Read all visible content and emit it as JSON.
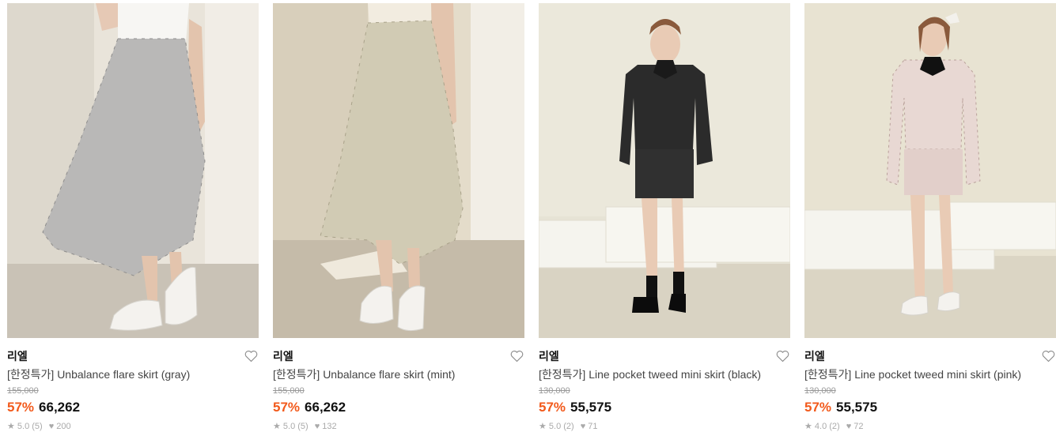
{
  "products": [
    {
      "brand": "리엘",
      "name": "[한정특가] Unbalance flare skirt (gray)",
      "original_price": "155,000",
      "discount": "57%",
      "price": "66,262",
      "rating": "★ 5.0 (5)",
      "likes": "♥ 200",
      "image": "model-gray-plaid-flare-skirt"
    },
    {
      "brand": "리엘",
      "name": "[한정특가] Unbalance flare skirt (mint)",
      "original_price": "155,000",
      "discount": "57%",
      "price": "66,262",
      "rating": "★ 5.0 (5)",
      "likes": "♥ 132",
      "image": "model-mint-plaid-flare-skirt"
    },
    {
      "brand": "리엘",
      "name": "[한정특가] Line pocket tweed mini skirt (black)",
      "original_price": "130,000",
      "discount": "57%",
      "price": "55,575",
      "rating": "★ 5.0 (2)",
      "likes": "♥ 71",
      "image": "model-black-tweed-set"
    },
    {
      "brand": "리엘",
      "name": "[한정특가] Line pocket tweed mini skirt (pink)",
      "original_price": "130,000",
      "discount": "57%",
      "price": "55,575",
      "rating": "★ 4.0 (2)",
      "likes": "♥ 72",
      "image": "model-pink-tweed-set"
    }
  ],
  "colors": {
    "discount": "#f25a1c",
    "price": "#111111",
    "muted": "#999999"
  }
}
